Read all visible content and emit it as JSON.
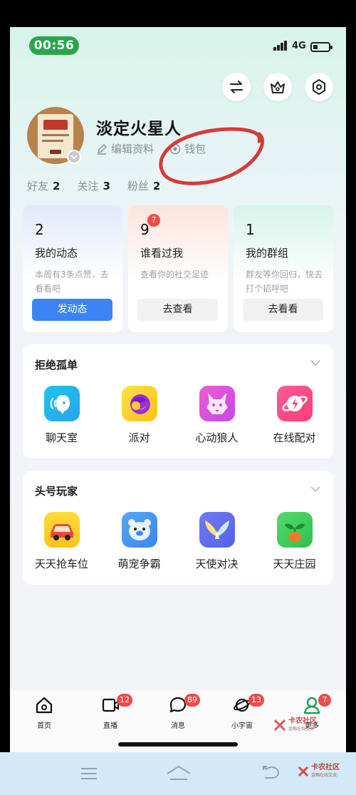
{
  "status_bar": {
    "time": "00:56",
    "network": "4G"
  },
  "top_buttons": {
    "switch_icon": "switch-arrows-icon",
    "crown_icon": "crown-icon",
    "settings_icon": "settings-hexagon-icon"
  },
  "profile": {
    "username": "淡定火星人",
    "edit_label": "编辑资料",
    "wallet_label": "钱包",
    "stats": [
      {
        "label": "好友",
        "value": "2"
      },
      {
        "label": "关注",
        "value": "3"
      },
      {
        "label": "粉丝",
        "value": "2"
      }
    ]
  },
  "top_cards": [
    {
      "number": "2",
      "badge": "",
      "title": "我的动态",
      "desc": "本周有3条点赞，去看看吧",
      "button": "发动态"
    },
    {
      "number": "9",
      "badge": "7",
      "title": "谁看过我",
      "desc": "查看你的社交足迹",
      "button": "去查看"
    },
    {
      "number": "1",
      "badge": "",
      "title": "我的群组",
      "desc": "群友等你回归，快去打个招呼吧",
      "button": "去看看"
    }
  ],
  "section_alone": {
    "title": "拒绝孤单",
    "items": [
      {
        "label": "聊天室",
        "icon": "chat-room-icon"
      },
      {
        "label": "派对",
        "icon": "party-icon"
      },
      {
        "label": "心动狼人",
        "icon": "werewolf-icon"
      },
      {
        "label": "在线配对",
        "icon": "online-match-icon"
      }
    ]
  },
  "section_player": {
    "title": "头号玩家",
    "items": [
      {
        "label": "天天抢车位",
        "icon": "car-icon"
      },
      {
        "label": "萌宠争霸",
        "icon": "pet-bear-icon"
      },
      {
        "label": "天使对决",
        "icon": "angel-wings-icon"
      },
      {
        "label": "天天庄园",
        "icon": "farm-sprout-icon"
      }
    ]
  },
  "tab_bar": [
    {
      "label": "首页",
      "badge": "",
      "icon": "home-icon"
    },
    {
      "label": "直播",
      "badge": "12",
      "icon": "live-icon"
    },
    {
      "label": "消息",
      "badge": "89",
      "icon": "message-icon"
    },
    {
      "label": "小宇宙",
      "badge": "13",
      "icon": "planet-icon"
    },
    {
      "label": "更多",
      "badge": "7",
      "icon": "profile-icon"
    }
  ],
  "watermark": {
    "title": "卡农社区",
    "subtitle": "金融在线交流"
  },
  "colors": {
    "accent_blue": "#3c84f3",
    "badge_red": "#f04a4a",
    "time_green": "#2aa64a",
    "profile_green": "#1aa05c"
  }
}
